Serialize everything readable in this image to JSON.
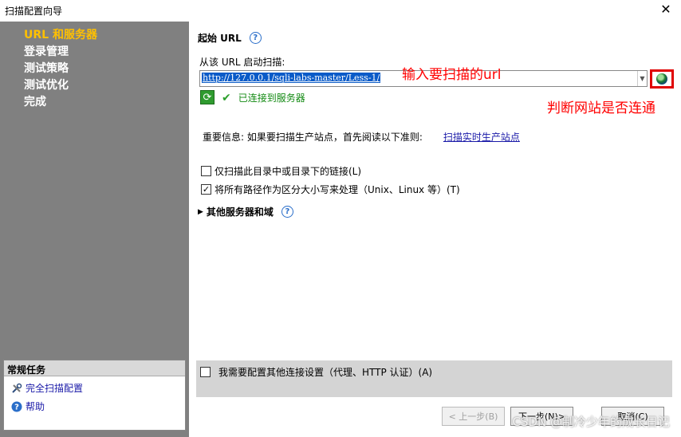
{
  "window": {
    "title": "扫描配置向导",
    "close": "✕"
  },
  "sidebar": {
    "steps": [
      {
        "label": "URL 和服务器",
        "active": true
      },
      {
        "label": "登录管理",
        "active": false
      },
      {
        "label": "测试策略",
        "active": false
      },
      {
        "label": "测试优化",
        "active": false
      },
      {
        "label": "完成",
        "active": false
      }
    ],
    "tasks": {
      "header": "常规任务",
      "items": [
        {
          "icon": "tools-icon",
          "label": "完全扫描配置"
        },
        {
          "icon": "help-icon",
          "label": "帮助"
        }
      ]
    }
  },
  "main": {
    "section_title": "起始 URL",
    "url_label": "从该 URL 启动扫描:",
    "url_value": "http://127.0.0.1/sqli-labs-master/Less-1/",
    "status_text": "已连接到服务器",
    "notice_text": "重要信息: 如果要扫描生产站点，首先阅读以下准则:",
    "notice_link": "扫描实时生产站点",
    "option1": {
      "label": "仅扫描此目录中或目录下的链接(L)",
      "checked": false
    },
    "option2": {
      "label": "将所有路径作为区分大小写来处理（Unix、Linux 等）(T)",
      "checked": true
    },
    "other_servers": "其他服务器和域",
    "connection_option": {
      "label": "我需要配置其他连接设置（代理、HTTP 认证）(A)",
      "checked": false
    }
  },
  "annotations": {
    "url_hint": "输入要扫描的url",
    "check_hint": "判断网站是否连通"
  },
  "buttons": {
    "back": "< 上一步(B)",
    "next": "下一步(N)>",
    "cancel": "取消(C)"
  },
  "watermark": "CSDN @制冷少年的成长日记",
  "colors": {
    "active_step": "#ffc000",
    "annotation": "#ff0000",
    "link": "#1a1aa8",
    "status": "#138a13"
  }
}
